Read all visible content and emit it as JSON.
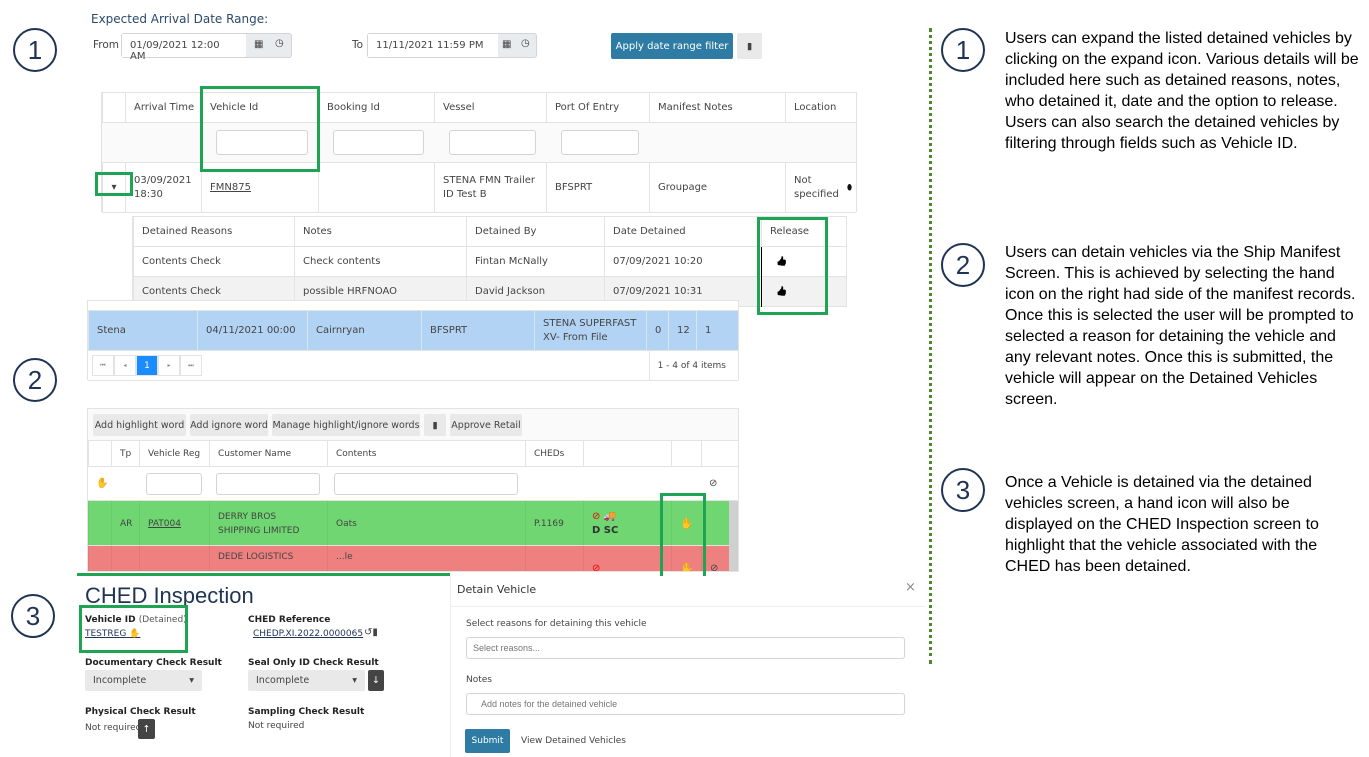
{
  "markers": [
    "1",
    "2",
    "3",
    "1",
    "2",
    "3"
  ],
  "descriptions": [
    "Users can expand the listed detained vehicles by clicking on the expand icon. Various details will be included here such as detained reasons, notes, who detained it, date and the option to release. Users can also search the detained vehicles by filtering through fields such as Vehicle ID.",
    "Users can detain vehicles via the Ship Manifest Screen. This is achieved by selecting the hand icon on the right had side of the manifest records. Once this is selected the user will be prompted to selected a reason for detaining the vehicle and any relevant notes. Once this is submitted, the vehicle will appear on the Detained Vehicles screen.",
    "Once a Vehicle is detained via the detained vehicles screen, a hand icon will also be displayed on the CHED Inspection screen to highlight that the vehicle associated with the CHED has been detained."
  ],
  "filter": {
    "title": "Expected Arrival Date Range:",
    "from_label": "From",
    "from_value": "01/09/2021 12:00 AM",
    "to_label": "To",
    "to_value": "11/11/2021 11:59 PM",
    "apply": "Apply date range filter"
  },
  "detained": {
    "headers": [
      "",
      "Arrival Time",
      "Vehicle Id",
      "Booking Id",
      "Vessel",
      "Port Of Entry",
      "Manifest Notes",
      "Location"
    ],
    "row": [
      "",
      "03/09/2021 18:30",
      "FMN875",
      "",
      "STENA FMN Trailer ID Test B",
      "BFSPRT",
      "Groupage",
      "Not specified"
    ],
    "sub_headers": [
      "Detained Reasons",
      "Notes",
      "Detained By",
      "Date Detained",
      "Release"
    ],
    "sub_rows": [
      [
        "Contents Check",
        "Check contents",
        "Fintan McNally",
        "07/09/2021 10:20",
        ""
      ],
      [
        "Contents Check",
        "possible HRFNOAO",
        "David Jackson",
        "07/09/2021 10:31",
        ""
      ]
    ]
  },
  "schedule": {
    "row": [
      "Stena",
      "04/11/2021 00:00",
      "Cairnryan",
      "BFSPRT",
      "STENA SUPERFAST XV- From File",
      "0",
      "12",
      "1"
    ],
    "page": "1",
    "items": "1 - 4 of 4 items"
  },
  "manifest": {
    "toolbar": [
      "Add highlight word",
      "Add ignore word",
      "Manage highlight/ignore words",
      "Approve Retail"
    ],
    "headers": [
      "",
      "Tp",
      "Vehicle Reg",
      "Customer Name",
      "Contents",
      "CHEDs",
      "",
      "",
      ""
    ],
    "rows": [
      [
        "",
        "AR",
        "PAT004",
        "DERRY BROS SHIPPING LIMITED",
        "Oats",
        "P.1169"
      ],
      [
        "",
        "",
        "",
        "DEDE LOGISTICS",
        "...le",
        ""
      ]
    ],
    "badges": [
      "D",
      "SC"
    ],
    "row_colors": [
      "#6fd672",
      "#ef8080"
    ]
  },
  "ched": {
    "title": "CHED Inspection",
    "vehicle_label": "Vehicle ID",
    "detained_tag": "(Detained)",
    "vehicle_value": "TESTREG",
    "ref_label": "CHED Reference",
    "ref_value": "CHEDP.XI.2022.0000065",
    "doc_label": "Documentary Check Result",
    "doc_value": "Incomplete",
    "seal_label": "Seal Only ID Check Result",
    "seal_value": "Incomplete",
    "phys_label": "Physical Check Result",
    "phys_value": "Not required",
    "samp_label": "Sampling Check Result",
    "samp_value": "Not required"
  },
  "modal": {
    "title": "Detain Vehicle",
    "close": "×",
    "reasons_label": "Select reasons for detaining this vehicle",
    "reasons_placeholder": "Select reasons...",
    "notes_label": "Notes",
    "notes_placeholder": "Add notes for the detained vehicle",
    "submit": "Submit",
    "view": "View Detained Vehicles"
  },
  "colors": {
    "accent": "#2e7ca3",
    "highlight": "#1fa454",
    "navy": "#1f3355",
    "selected_row": "#b3d3f5"
  }
}
